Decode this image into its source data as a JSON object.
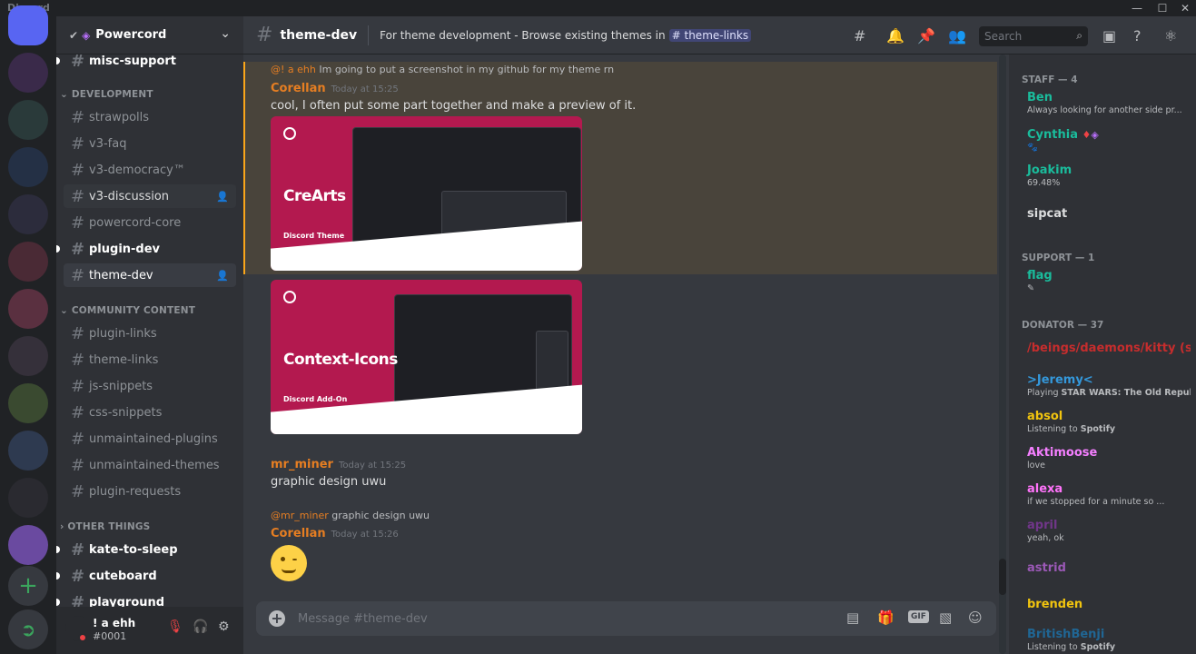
{
  "window": {
    "app_name": "Discord",
    "min": "—",
    "max": "☐",
    "close": "✕"
  },
  "server": {
    "name": "Powercord"
  },
  "categories": {
    "development": "DEVELOPMENT",
    "community": "COMMUNITY CONTENT",
    "other": "OTHER THINGS"
  },
  "channels": {
    "misc_support": "misc-support",
    "strawpolls": "strawpolls",
    "v3_faq": "v3-faq",
    "v3_democracy": "v3-democracy™",
    "v3_discussion": "v3-discussion",
    "powercord_core": "powercord-core",
    "plugin_dev": "plugin-dev",
    "theme_dev": "theme-dev",
    "plugin_links": "plugin-links",
    "theme_links": "theme-links",
    "js_snippets": "js-snippets",
    "css_snippets": "css-snippets",
    "unmaintained_plugins": "unmaintained-plugins",
    "unmaintained_themes": "unmaintained-themes",
    "plugin_requests": "plugin-requests",
    "kate_to_sleep": "kate-to-sleep",
    "cuteboard": "cuteboard",
    "playground": "playground"
  },
  "user": {
    "name": "! a ehh",
    "tag": "#0001"
  },
  "header": {
    "channel": "theme-dev",
    "topic": "For theme development - Browse existing themes in",
    "topic_link": "theme-links",
    "search_placeholder": "Search"
  },
  "messages": {
    "m1_reply_mention": "@! a ehh",
    "m1_reply_text": "Im going to put a screenshot in my github for my theme rn",
    "m1_author": "Corellan",
    "m1_time": "Today at 15:25",
    "m1_text": "cool, I often put some part together and make a preview of it.",
    "embed1_title": "CreArts",
    "embed1_sub": "Discord Theme",
    "embed2_title": "Context-Icons",
    "embed2_sub": "Discord Add-On",
    "m2_author": "mr_miner",
    "m2_time": "Today at 15:25",
    "m2_text": "graphic design uwu",
    "m3_reply_mention": "@mr_miner",
    "m3_reply_text": "graphic design uwu",
    "m3_author": "Corellan",
    "m3_time": "Today at 15:26"
  },
  "composer": {
    "placeholder": "Message #theme-dev",
    "gif": "GIF"
  },
  "members": {
    "staff": "STAFF — 4",
    "support": "SUPPORT — 1",
    "donator": "DONATOR — 37",
    "list": [
      {
        "name": "Ben",
        "activity": "Always looking for another side pr..."
      },
      {
        "name": "Cynthia",
        "activity": ""
      },
      {
        "name": "Joakim",
        "activity": "69.48%"
      },
      {
        "name": "sipcat",
        "activity": ""
      },
      {
        "name": "flag",
        "activity": ""
      },
      {
        "name": "/beings/daemons/kitty (she...",
        "activity": ""
      },
      {
        "name": ">Jeremy<",
        "activity_prefix": "Playing",
        "activity": "STAR WARS: The Old Republic"
      },
      {
        "name": "absol",
        "activity_prefix": "Listening to",
        "activity": "Spotify"
      },
      {
        "name": "Aktimoose",
        "activity": "love"
      },
      {
        "name": "alexa",
        "activity": "if we stopped for a minute so ..."
      },
      {
        "name": "april",
        "activity": "yeah, ok"
      },
      {
        "name": "astrid",
        "activity": ""
      },
      {
        "name": "brenden",
        "activity": ""
      },
      {
        "name": "BritishBenji",
        "activity_prefix": "Listening to",
        "activity": "Spotify"
      }
    ]
  },
  "colors": {
    "corellan": "#e67e22",
    "mr_miner": "#e67e22",
    "staff": "#1abc9c",
    "ben": "#1abc9c",
    "sipcat": "#dcddde",
    "kitty": "#c62d2d",
    "jeremy": "#3498db",
    "absol": "#f1c40f",
    "aktimoose": "#f47fff",
    "alexa": "#ff73fa",
    "april": "#71368a",
    "astrid": "#9b59b6",
    "brenden": "#f1c40f",
    "britishbenji": "#206694"
  }
}
